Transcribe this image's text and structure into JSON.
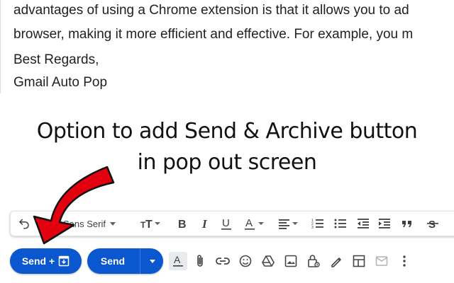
{
  "email": {
    "lines": [
      "advantages of using a Chrome extension is that it allows you to ad",
      "browser, making it more efficient and effective. For example, you m",
      "Best Regards,",
      "Gmail Auto Pop"
    ]
  },
  "caption": {
    "line1": "Option to add Send & Archive button",
    "line2": "in pop out screen"
  },
  "toolbar": {
    "font_name": "Sans Serif",
    "icons": [
      "undo-icon",
      "text-size-icon",
      "bold-icon",
      "italic-icon",
      "underline-icon",
      "text-color-icon",
      "align-icon",
      "numbered-list-icon",
      "bulleted-list-icon",
      "indent-less-icon",
      "indent-more-icon",
      "quote-icon",
      "strikethrough-icon"
    ]
  },
  "actions": {
    "send_archive_label": "Send +",
    "send_label": "Send"
  },
  "colors": {
    "accent": "#0b57d0",
    "arrow": "#e3000f"
  }
}
